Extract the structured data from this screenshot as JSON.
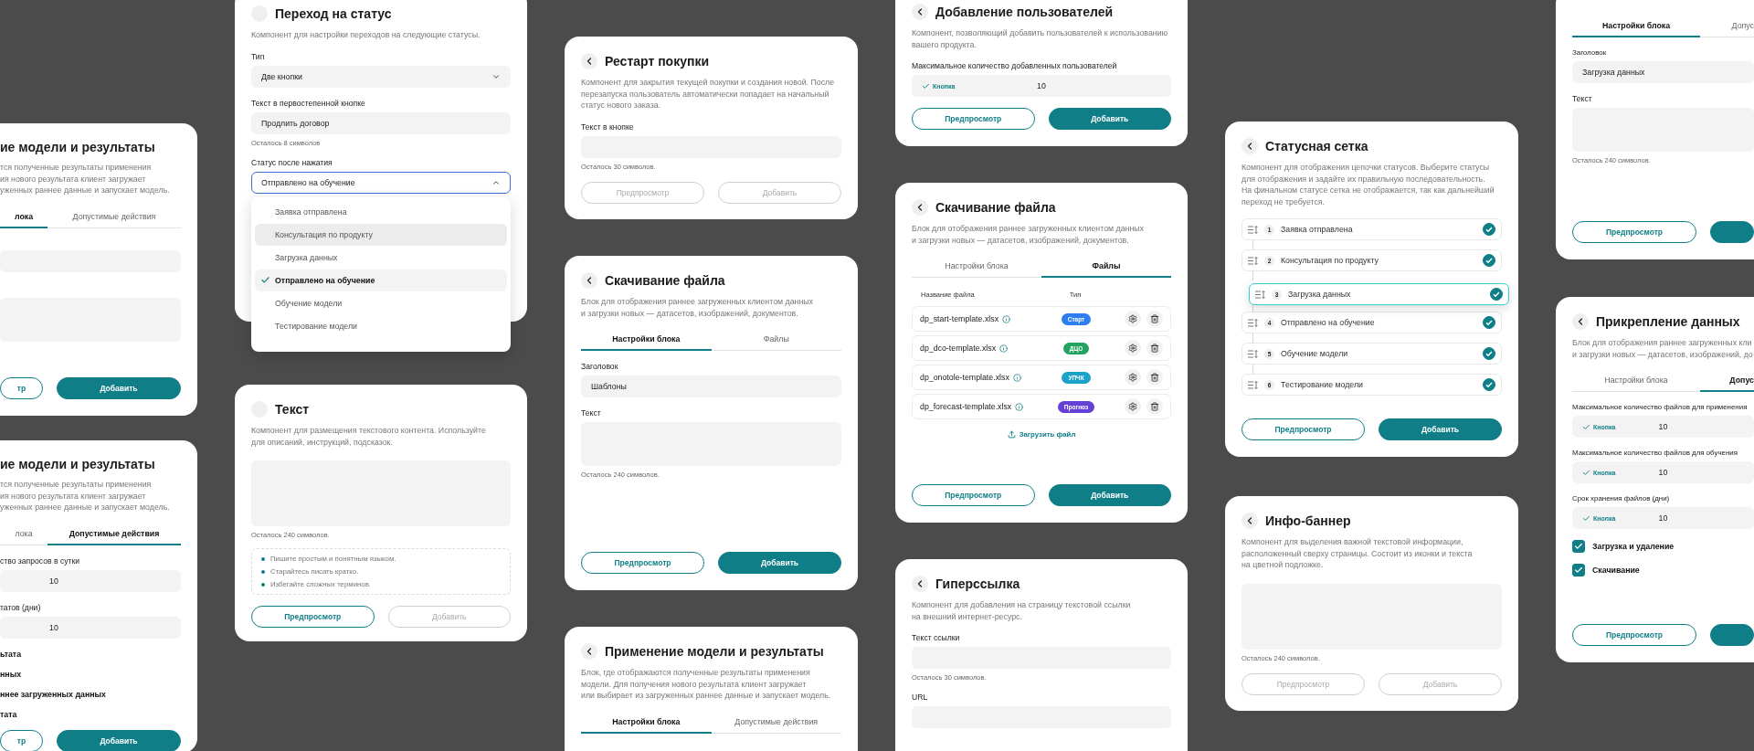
{
  "columns": [
    {
      "cards": [
        {
          "title": "ие модели и результаты",
          "description": "тся полученные результаты применения\nия нового результата клиент загружает\nуженных раннее данные и запускает модель.",
          "blocks": [
            {
              "kind": "tabs",
              "tabs": [
                {
                  "label": "лока",
                  "selected": true
                },
                {
                  "label": "Допустимые действия",
                  "selected": false
                }
              ]
            },
            {
              "kind": "field"
            },
            {
              "kind": "textarea"
            },
            {
              "kind": "buttons",
              "buttons": [
                {
                  "kind": "outline",
                  "label": "тр",
                  "disabled": false
                },
                {
                  "kind": "filled",
                  "label": "Добавить",
                  "disabled": false
                }
              ]
            }
          ]
        },
        {
          "title": "ие модели и результаты",
          "description": "тся полученные результаты применения\nия нового результата клиент загружает\nуженных раннее данные и запускает модель.",
          "blocks": [
            {
              "kind": "tabs",
              "tabs": [
                {
                  "label": "лока",
                  "selected": false
                },
                {
                  "label": "Допустимые действия",
                  "selected": true
                }
              ]
            },
            {
              "kind": "field",
              "label": "ство запросов в сутки",
              "value": "10"
            },
            {
              "kind": "field",
              "label": "татов (дни)",
              "value": "10"
            },
            {
              "kind": "options",
              "items": [
                "ьтата",
                "нных",
                "ннее загруженных данных",
                "тата"
              ]
            },
            {
              "kind": "buttons",
              "buttons": [
                {
                  "kind": "outline",
                  "label": "тр",
                  "disabled": false
                },
                {
                  "kind": "filled",
                  "label": "Добавить",
                  "disabled": false
                }
              ]
            }
          ]
        }
      ]
    },
    {
      "cards": [
        {
          "title": "Переход на статус",
          "description": "Компонент для настройки переходов на следующие статусы.",
          "blocks": [
            {
              "kind": "select",
              "label": "Тип",
              "value": "Две кнопки",
              "open": false
            },
            {
              "kind": "field",
              "label": "Текст в первостепенной кнопке",
              "value": "Продлить договор",
              "hint": "Осталось 8 символов"
            },
            {
              "kind": "select",
              "label": "Статус после нажатия",
              "value": "Отправлено на обучение",
              "open": true,
              "options": [
                {
                  "label": "Заявка отправлена",
                  "selected": false,
                  "hovered": false
                },
                {
                  "label": "Консультация по продукту",
                  "selected": false,
                  "hovered": true
                },
                {
                  "label": "Загрузка данных",
                  "selected": false,
                  "hovered": false
                },
                {
                  "label": "Отправлено на обучение",
                  "selected": true,
                  "hovered": false
                },
                {
                  "label": "Обучение модели",
                  "selected": false,
                  "hovered": false
                },
                {
                  "label": "Тестирование модели",
                  "selected": false,
                  "hovered": false
                }
              ]
            }
          ]
        },
        {
          "title": "Текст",
          "description": "Компонент для размещения текстового контента. Используйте\nдля описаний, инструкций, подсказок.",
          "blocks": [
            {
              "kind": "textarea",
              "hint": "Осталось 240 символов."
            },
            {
              "kind": "tips",
              "items": [
                "Пишите простым и понятным языком.",
                "Старайтесь писать кратко.",
                "Избегайте сложных терминов."
              ]
            },
            {
              "kind": "buttons",
              "buttons": [
                {
                  "kind": "outline",
                  "label": "Предпросмотр",
                  "disabled": false
                },
                {
                  "kind": "outline",
                  "label": "Добавить",
                  "disabled": true
                }
              ]
            }
          ]
        }
      ]
    },
    {
      "cards": [
        {
          "title": "Рестарт покупки",
          "description": "Компонент для закрытия текущей покупки и создания новой. После\nперезапуска пользователь автоматически попадает на начальный\nстатус нового заказа.",
          "blocks": [
            {
              "kind": "field",
              "label": "Текст в кнопке",
              "hint": "Осталось 30 символов."
            },
            {
              "kind": "buttons",
              "buttons": [
                {
                  "kind": "outline",
                  "label": "Предпросмотр",
                  "disabled": true
                },
                {
                  "kind": "outline",
                  "label": "Добавить",
                  "disabled": true
                }
              ]
            }
          ]
        },
        {
          "title": "Скачивание файла",
          "description": "Блок для отображения раннее загруженных клиентом данных\nи загрузки новых — датасетов, изображений, документов.",
          "blocks": [
            {
              "kind": "tabs",
              "tabs": [
                {
                  "label": "Настройки блока",
                  "selected": true
                },
                {
                  "label": "Файлы",
                  "selected": false
                }
              ]
            },
            {
              "kind": "field",
              "label": "Заголовок",
              "value": "Шаблоны"
            },
            {
              "kind": "textarea",
              "label": "Текст",
              "hint": "Осталось 240 символов."
            },
            {
              "kind": "buttons",
              "buttons": [
                {
                  "kind": "outline",
                  "label": "Предпросмотр",
                  "disabled": false
                },
                {
                  "kind": "filled",
                  "label": "Добавить",
                  "disabled": false
                }
              ]
            }
          ]
        },
        {
          "title": "Применение модели и результаты",
          "description": "Блок, где отображаются полученные результаты применения\nмодели. Для получения нового результата клиент загружает\nили выбирает из загруженных раннее данные и запускает модель.",
          "blocks": [
            {
              "kind": "tabs",
              "tabs": [
                {
                  "label": "Настройки блока",
                  "selected": true
                },
                {
                  "label": "Допустимые действия",
                  "selected": false
                }
              ]
            }
          ]
        }
      ]
    },
    {
      "cards": [
        {
          "title": "Добавление пользователей",
          "description": "Компонент, позволяющий добавить пользователей к использованию\nвашего продукта.",
          "blocks": [
            {
              "kind": "field",
              "label": "Максимальное количество добавленных пользователей",
              "chip": "Кнопка",
              "value": "10"
            },
            {
              "kind": "buttons",
              "buttons": [
                {
                  "kind": "outline",
                  "label": "Предпросмотр",
                  "disabled": false
                },
                {
                  "kind": "filled",
                  "label": "Добавить",
                  "disabled": false
                }
              ]
            }
          ]
        },
        {
          "title": "Скачивание файла",
          "description": "Блок для отображения раннее загруженных клиентом данных\nи загрузки новых — датасетов, изображений, документов.",
          "blocks": [
            {
              "kind": "tabs",
              "tabs": [
                {
                  "label": "Настройки блока",
                  "selected": false
                },
                {
                  "label": "Файлы",
                  "selected": true
                }
              ]
            },
            {
              "kind": "files",
              "columns": [
                "Название файла",
                "Тип"
              ],
              "rows": [
                {
                  "name": "dp_start-template.xlsx",
                  "type": "Старт",
                  "color": "#2d7ff0"
                },
                {
                  "name": "dp_dco-template.xlsx",
                  "type": "ДЦО",
                  "color": "#22a35f"
                },
                {
                  "name": "dp_onotole-template.xlsx",
                  "type": "УПЧК",
                  "color": "#1aa2c8"
                },
                {
                  "name": "dp_forecast-template.xlsx",
                  "type": "Прогноз",
                  "color": "#6440d8"
                }
              ]
            },
            {
              "kind": "link",
              "label": "Загрузить файл"
            },
            {
              "kind": "buttons",
              "buttons": [
                {
                  "kind": "outline",
                  "label": "Предпросмотр",
                  "disabled": false
                },
                {
                  "kind": "filled",
                  "label": "Добавить",
                  "disabled": false
                }
              ]
            }
          ]
        },
        {
          "title": "Гиперссылка",
          "description": "Компонент для добавления на страницу текстовой ссылки\nна внешний интернет-ресурс.",
          "blocks": [
            {
              "kind": "field",
              "label": "Текст ссылки",
              "hint": "Осталось 30 символов."
            },
            {
              "kind": "field",
              "label": "URL"
            }
          ]
        }
      ]
    },
    {
      "cards": [
        {
          "title": "Статусная сетка",
          "description": "Компонент для отображения цепочки статусов. Выберите статусы\nдля отображения и задайте их правильную последовательность.\nНа финальном статусе сетка не отображается, так как дальнейший\nпереход не требуется.",
          "blocks": [
            {
              "kind": "statuses",
              "items": [
                {
                  "number": "1",
                  "label": "Заявка отправлена",
                  "checked": true,
                  "dragging": false
                },
                {
                  "number": "2",
                  "label": "Консультация по продукту",
                  "checked": true,
                  "dragging": false
                },
                {
                  "number": "3",
                  "label": "Загрузка данных",
                  "checked": true,
                  "dragging": true
                },
                {
                  "number": "4",
                  "label": "Отправлено на обучение",
                  "checked": true,
                  "dragging": false
                },
                {
                  "number": "5",
                  "label": "Обучение модели",
                  "checked": true,
                  "dragging": false
                },
                {
                  "number": "6",
                  "label": "Тестирование модели",
                  "checked": true,
                  "dragging": false
                }
              ]
            },
            {
              "kind": "buttons",
              "buttons": [
                {
                  "kind": "outline",
                  "label": "Предпросмотр",
                  "disabled": false
                },
                {
                  "kind": "filled",
                  "label": "Добавить",
                  "disabled": false
                }
              ]
            }
          ]
        },
        {
          "title": "Инфо-баннер",
          "description": "Компонент для выделения важной текстовой информации,\nрасположенный сверху страницы. Состоит из иконки и текста\nна цветной подложке.",
          "blocks": [
            {
              "kind": "textarea",
              "hint": "Осталось 240 символов."
            },
            {
              "kind": "buttons",
              "buttons": [
                {
                  "kind": "outline",
                  "label": "Предпросмотр",
                  "disabled": true
                },
                {
                  "kind": "outline",
                  "label": "Добавить",
                  "disabled": true
                }
              ]
            }
          ]
        }
      ]
    },
    {
      "cards": [
        {
          "blocks": [
            {
              "kind": "tabs",
              "tabs": [
                {
                  "label": "Настройки блока",
                  "selected": true
                },
                {
                  "label": "Допус",
                  "selected": false
                }
              ]
            },
            {
              "kind": "field",
              "label": "Заголовок",
              "value": "Загрузка данных"
            },
            {
              "kind": "textarea",
              "label": "Текст",
              "hint": "Осталось 240 символов."
            },
            {
              "kind": "buttons",
              "buttons": [
                {
                  "kind": "outline",
                  "label": "Предпросмотр",
                  "disabled": false
                },
                {
                  "kind": "filled",
                  "disabled": false
                }
              ]
            }
          ]
        },
        {
          "title": "Прикрепление данных",
          "description": "Блок для отображения раннее загруженных кли\nи загрузки новых — датасетов, изображений, до",
          "blocks": [
            {
              "kind": "tabs",
              "tabs": [
                {
                  "label": "Настройки блока",
                  "selected": false
                },
                {
                  "label": "Допус",
                  "selected": true
                }
              ]
            },
            {
              "kind": "field",
              "label": "Максимальное количество файлов для применения",
              "chip": "Кнопка",
              "value": "10"
            },
            {
              "kind": "field",
              "label": "Максимальное количество файлов для обучения",
              "chip": "Кнопка",
              "value": "10"
            },
            {
              "kind": "field",
              "label": "Срок хранения файлов (дни)",
              "chip": "Кнопка",
              "value": "10"
            },
            {
              "kind": "checkbox",
              "label": "Загрузка и удаление",
              "checked": true
            },
            {
              "kind": "checkbox",
              "label": "Скачивание",
              "checked": true
            },
            {
              "kind": "buttons",
              "buttons": [
                {
                  "kind": "outline",
                  "label": "Предпросмотр",
                  "disabled": false
                },
                {
                  "kind": "filled",
                  "disabled": false
                }
              ]
            }
          ]
        }
      ]
    }
  ]
}
